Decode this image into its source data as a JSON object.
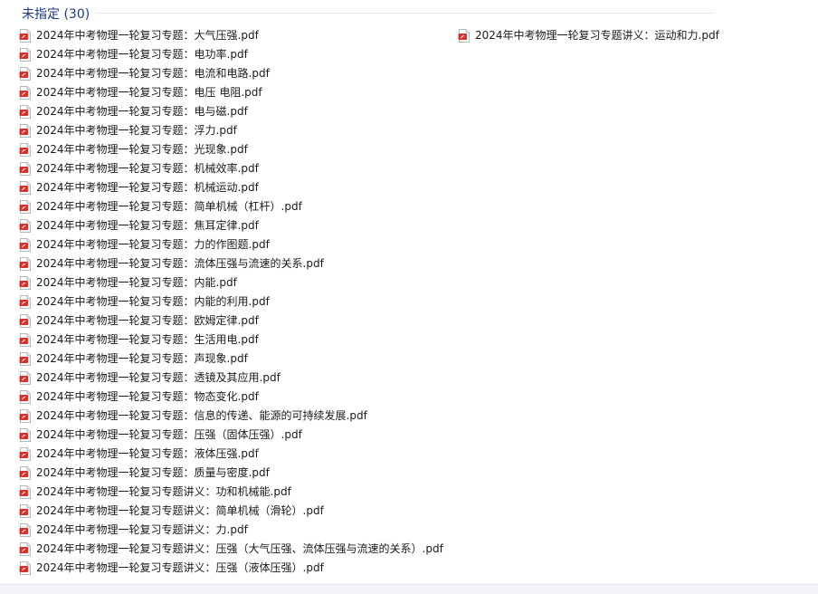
{
  "group": {
    "label": "未指定",
    "count": "(30)"
  },
  "icon": "pdf-file-icon",
  "colors": {
    "header": "#1e3a8a",
    "pdf_red": "#d9302c"
  },
  "files_col1": [
    "2024年中考物理一轮复习专题：大气压强.pdf",
    "2024年中考物理一轮复习专题：电功率.pdf",
    "2024年中考物理一轮复习专题：电流和电路.pdf",
    "2024年中考物理一轮复习专题：电压 电阻.pdf",
    "2024年中考物理一轮复习专题：电与磁.pdf",
    "2024年中考物理一轮复习专题：浮力.pdf",
    "2024年中考物理一轮复习专题：光现象.pdf",
    "2024年中考物理一轮复习专题：机械效率.pdf",
    "2024年中考物理一轮复习专题：机械运动.pdf",
    "2024年中考物理一轮复习专题：简单机械（杠杆）.pdf",
    "2024年中考物理一轮复习专题：焦耳定律.pdf",
    "2024年中考物理一轮复习专题：力的作图题.pdf",
    "2024年中考物理一轮复习专题：流体压强与流速的关系.pdf",
    "2024年中考物理一轮复习专题：内能.pdf",
    "2024年中考物理一轮复习专题：内能的利用.pdf",
    "2024年中考物理一轮复习专题：欧姆定律.pdf",
    "2024年中考物理一轮复习专题：生活用电.pdf",
    "2024年中考物理一轮复习专题：声现象.pdf",
    "2024年中考物理一轮复习专题：透镜及其应用.pdf",
    "2024年中考物理一轮复习专题：物态变化.pdf",
    "2024年中考物理一轮复习专题：信息的传递、能源的可持续发展.pdf",
    "2024年中考物理一轮复习专题：压强（固体压强）.pdf",
    "2024年中考物理一轮复习专题：液体压强.pdf",
    "2024年中考物理一轮复习专题：质量与密度.pdf",
    "2024年中考物理一轮复习专题讲义：功和机械能.pdf",
    "2024年中考物理一轮复习专题讲义：简单机械（滑轮）.pdf",
    "2024年中考物理一轮复习专题讲义：力.pdf",
    "2024年中考物理一轮复习专题讲义：压强（大气压强、流体压强与流速的关系）.pdf",
    "2024年中考物理一轮复习专题讲义：压强（液体压强）.pdf"
  ],
  "files_col2": [
    "2024年中考物理一轮复习专题讲义：运动和力.pdf"
  ]
}
